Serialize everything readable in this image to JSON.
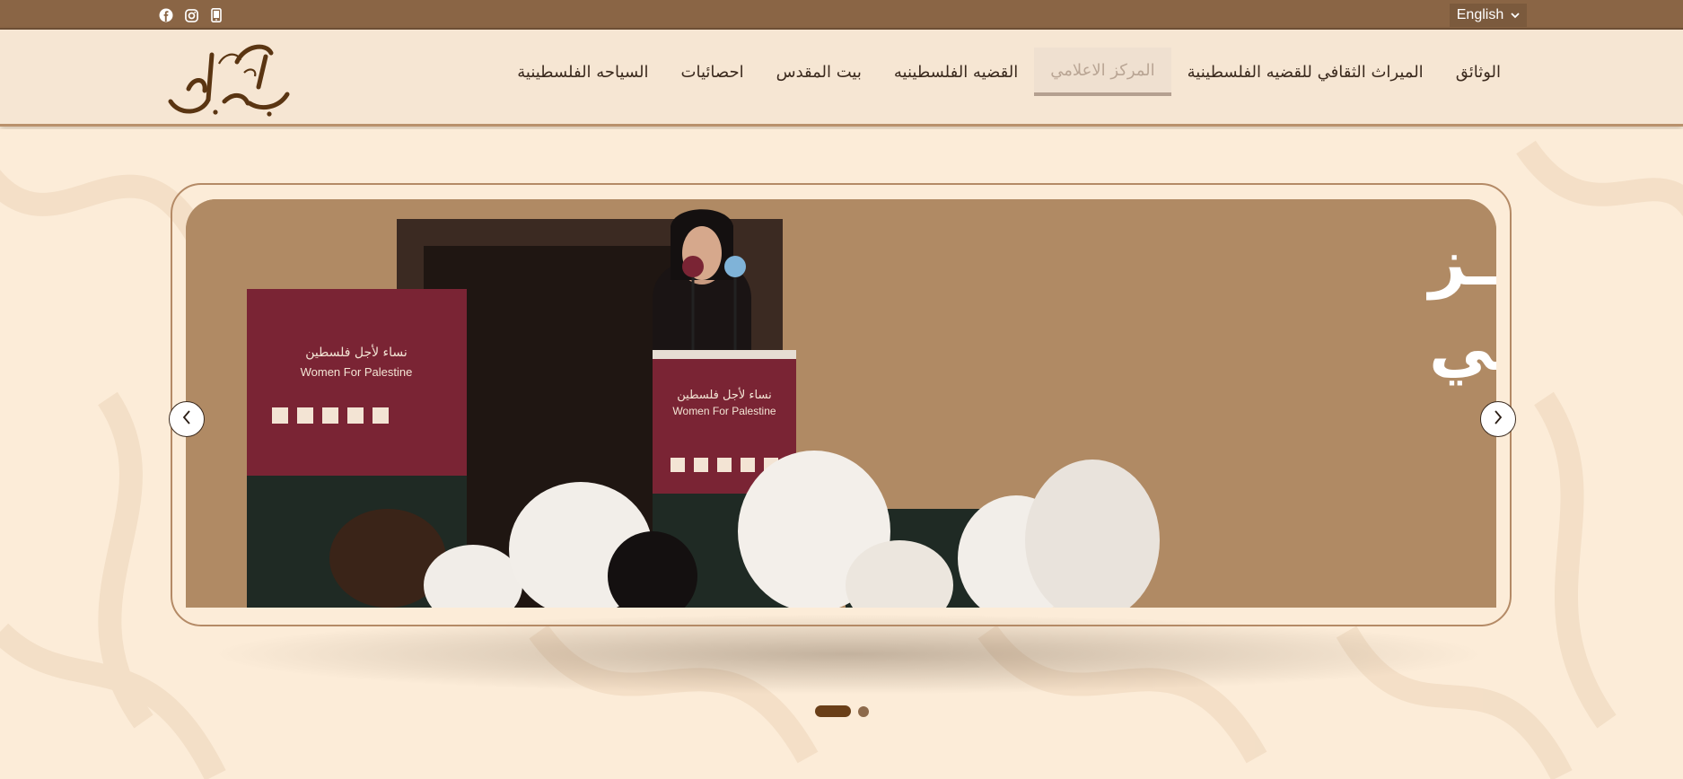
{
  "topbar": {
    "social_icons": [
      "facebook-icon",
      "instagram-icon",
      "mobile-icon"
    ],
    "language": "English"
  },
  "header": {
    "logo_text": "فلسطين القدس",
    "nav": [
      {
        "label": "الوثائق",
        "active": false
      },
      {
        "label": "الميراث الثقافي للقضيه الفلسطينية",
        "active": false
      },
      {
        "label": "المركز الاعلامي",
        "active": true
      },
      {
        "label": "القضيه الفلسطينيه",
        "active": false
      },
      {
        "label": "بيت المقدس",
        "active": false
      },
      {
        "label": "احصائيات",
        "active": false
      },
      {
        "label": "السياحه الفلسطينية",
        "active": false
      }
    ]
  },
  "slider": {
    "title_line1": "المركـــــــز",
    "title_line2": "الإعلامــــــي",
    "podium_arabic": "نساء لأجل فلسطين",
    "podium_english": "Women For Palestine",
    "slide_count": 2,
    "active_slide": 1
  },
  "colors": {
    "topbar": "#8a6545",
    "header_bg": "#f6e6d3",
    "accent_brown": "#6a3f18",
    "slide_bg": "#b08a64"
  }
}
